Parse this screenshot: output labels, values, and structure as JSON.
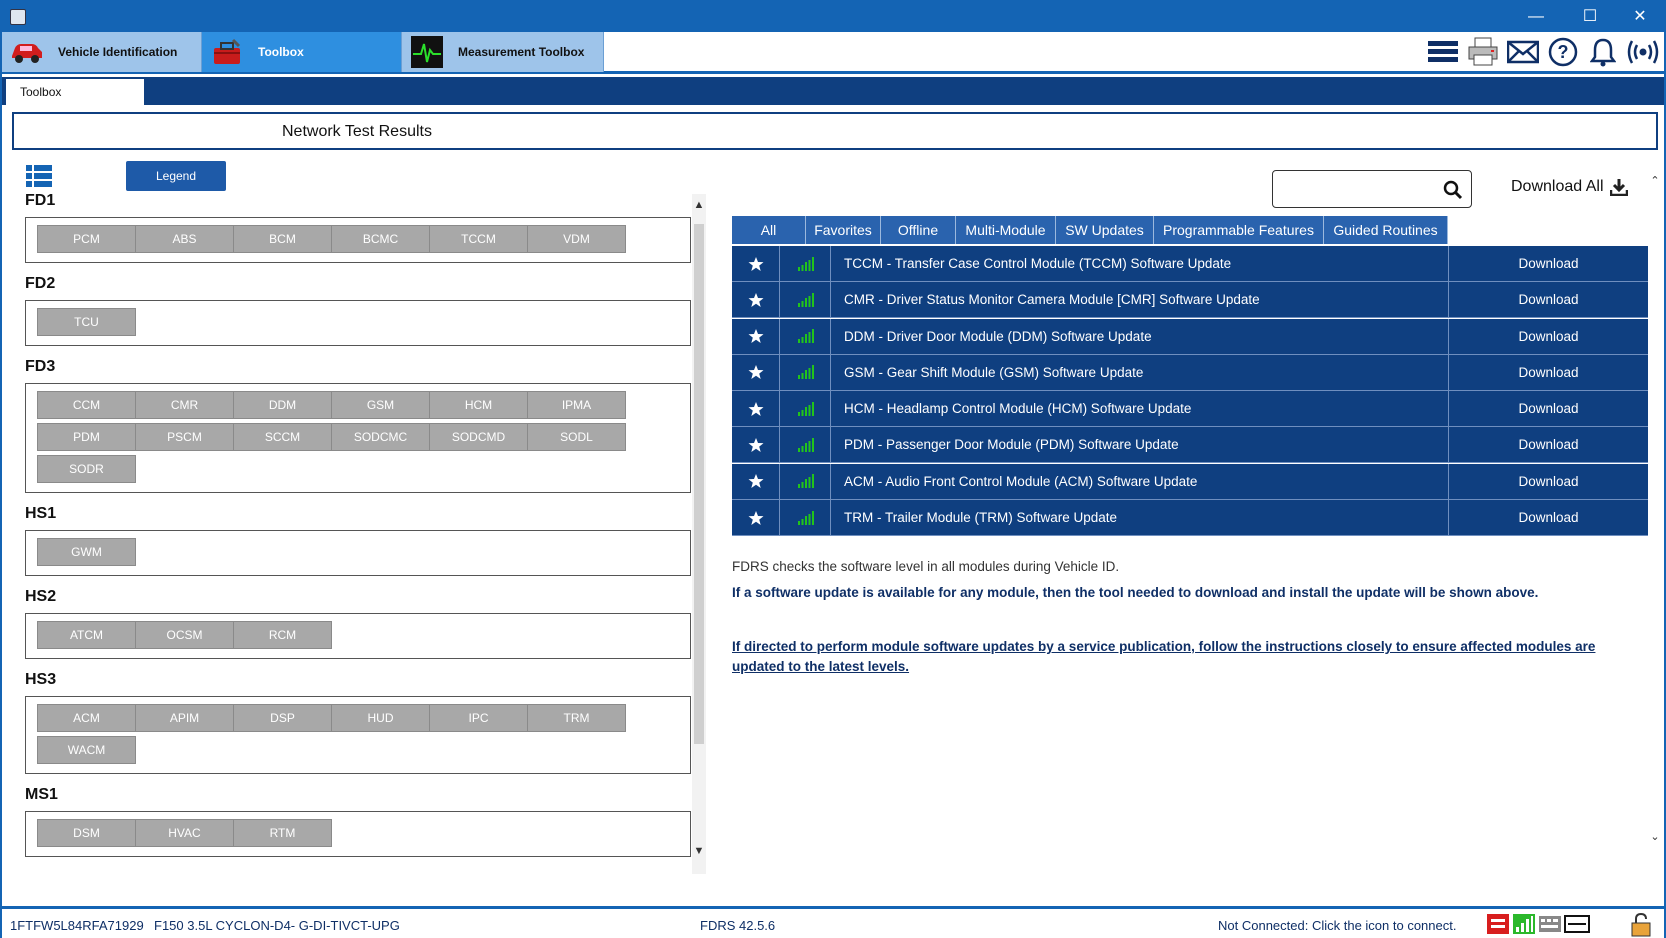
{
  "window": {
    "minimize": "—",
    "maximize": "☐",
    "close": "✕"
  },
  "main_tabs": [
    {
      "label": "Vehicle Identification"
    },
    {
      "label": "Toolbox"
    },
    {
      "label": "Measurement Toolbox"
    }
  ],
  "sub_tab": {
    "label": "Toolbox"
  },
  "header": {
    "title": "Network Test Results"
  },
  "legend_button": "Legend",
  "networks": [
    {
      "name": "FD1",
      "modules": [
        "PCM",
        "ABS",
        "BCM",
        "BCMC",
        "TCCM",
        "VDM"
      ]
    },
    {
      "name": "FD2",
      "modules": [
        "TCU"
      ]
    },
    {
      "name": "FD3",
      "modules": [
        "CCM",
        "CMR",
        "DDM",
        "GSM",
        "HCM",
        "IPMA",
        "PDM",
        "PSCM",
        "SCCM",
        "SODCMC",
        "SODCMD",
        "SODL",
        "SODR"
      ]
    },
    {
      "name": "HS1",
      "modules": [
        "GWM"
      ]
    },
    {
      "name": "HS2",
      "modules": [
        "ATCM",
        "OCSM",
        "RCM"
      ]
    },
    {
      "name": "HS3",
      "modules": [
        "ACM",
        "APIM",
        "DSP",
        "HUD",
        "IPC",
        "TRM",
        "WACM"
      ]
    },
    {
      "name": "MS1",
      "modules": [
        "DSM",
        "HVAC",
        "RTM"
      ]
    }
  ],
  "search": {
    "value": "",
    "placeholder": ""
  },
  "download_all": "Download All",
  "filter_tabs": [
    "All",
    "Favorites",
    "Offline",
    "Multi-Module",
    "SW Updates",
    "Programmable Features",
    "Guided Routines"
  ],
  "updates": [
    {
      "name": "TCCM - Transfer Case Control Module (TCCM) Software Update",
      "action": "Download"
    },
    {
      "name": "CMR - Driver Status Monitor Camera Module [CMR] Software Update",
      "action": "Download"
    },
    {
      "name": "DDM - Driver Door Module (DDM) Software Update",
      "action": "Download"
    },
    {
      "name": "GSM - Gear Shift Module (GSM) Software Update",
      "action": "Download"
    },
    {
      "name": "HCM - Headlamp Control Module (HCM) Software Update",
      "action": "Download"
    },
    {
      "name": "PDM - Passenger Door Module (PDM) Software Update",
      "action": "Download"
    },
    {
      "name": "ACM - Audio Front Control Module (ACM) Software Update",
      "action": "Download"
    },
    {
      "name": "TRM - Trailer Module (TRM) Software Update",
      "action": "Download"
    }
  ],
  "info": {
    "line1": "FDRS checks the software level in all modules during Vehicle ID.",
    "line2": "If a software update is available for any module, then the tool needed to download and install the update will be shown above.",
    "line3": "If directed to perform module software updates by a service publication, follow the instructions closely to ensure affected modules are updated to the latest levels."
  },
  "status": {
    "vin": "1FTFW5L84RFA71929",
    "vehicle": "F150 3.5L CYCLON-D4- G-DI-TIVCT-UPG",
    "version": "FDRS 42.5.6",
    "connection": "Not Connected: Click the icon to connect."
  },
  "colors": {
    "accent": "#1464b4",
    "dark_blue": "#0f3f80",
    "module_gray": "#a8a8a8",
    "signal_green": "#22c41a"
  }
}
